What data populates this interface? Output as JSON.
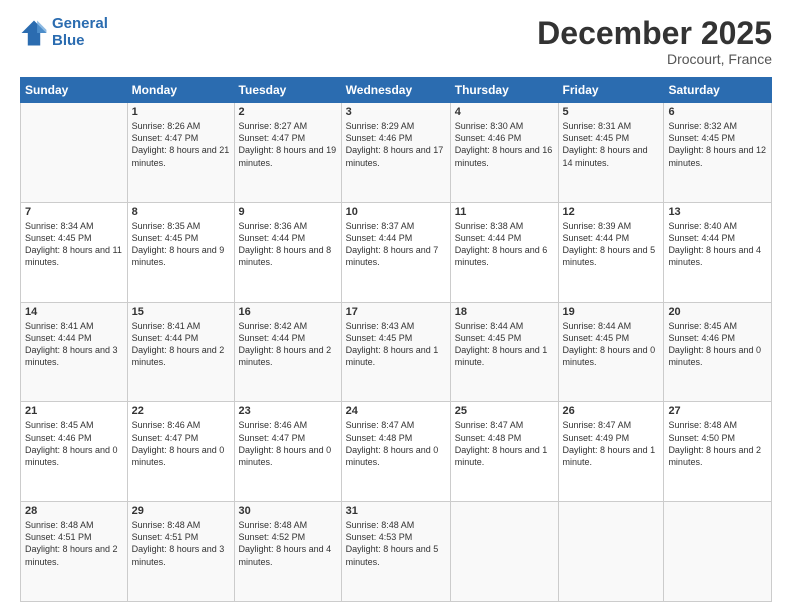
{
  "logo": {
    "line1": "General",
    "line2": "Blue"
  },
  "title": "December 2025",
  "location": "Drocourt, France",
  "header_days": [
    "Sunday",
    "Monday",
    "Tuesday",
    "Wednesday",
    "Thursday",
    "Friday",
    "Saturday"
  ],
  "weeks": [
    [
      {
        "day": "",
        "sunrise": "",
        "sunset": "",
        "daylight": ""
      },
      {
        "day": "1",
        "sunrise": "Sunrise: 8:26 AM",
        "sunset": "Sunset: 4:47 PM",
        "daylight": "Daylight: 8 hours and 21 minutes."
      },
      {
        "day": "2",
        "sunrise": "Sunrise: 8:27 AM",
        "sunset": "Sunset: 4:47 PM",
        "daylight": "Daylight: 8 hours and 19 minutes."
      },
      {
        "day": "3",
        "sunrise": "Sunrise: 8:29 AM",
        "sunset": "Sunset: 4:46 PM",
        "daylight": "Daylight: 8 hours and 17 minutes."
      },
      {
        "day": "4",
        "sunrise": "Sunrise: 8:30 AM",
        "sunset": "Sunset: 4:46 PM",
        "daylight": "Daylight: 8 hours and 16 minutes."
      },
      {
        "day": "5",
        "sunrise": "Sunrise: 8:31 AM",
        "sunset": "Sunset: 4:45 PM",
        "daylight": "Daylight: 8 hours and 14 minutes."
      },
      {
        "day": "6",
        "sunrise": "Sunrise: 8:32 AM",
        "sunset": "Sunset: 4:45 PM",
        "daylight": "Daylight: 8 hours and 12 minutes."
      }
    ],
    [
      {
        "day": "7",
        "sunrise": "Sunrise: 8:34 AM",
        "sunset": "Sunset: 4:45 PM",
        "daylight": "Daylight: 8 hours and 11 minutes."
      },
      {
        "day": "8",
        "sunrise": "Sunrise: 8:35 AM",
        "sunset": "Sunset: 4:45 PM",
        "daylight": "Daylight: 8 hours and 9 minutes."
      },
      {
        "day": "9",
        "sunrise": "Sunrise: 8:36 AM",
        "sunset": "Sunset: 4:44 PM",
        "daylight": "Daylight: 8 hours and 8 minutes."
      },
      {
        "day": "10",
        "sunrise": "Sunrise: 8:37 AM",
        "sunset": "Sunset: 4:44 PM",
        "daylight": "Daylight: 8 hours and 7 minutes."
      },
      {
        "day": "11",
        "sunrise": "Sunrise: 8:38 AM",
        "sunset": "Sunset: 4:44 PM",
        "daylight": "Daylight: 8 hours and 6 minutes."
      },
      {
        "day": "12",
        "sunrise": "Sunrise: 8:39 AM",
        "sunset": "Sunset: 4:44 PM",
        "daylight": "Daylight: 8 hours and 5 minutes."
      },
      {
        "day": "13",
        "sunrise": "Sunrise: 8:40 AM",
        "sunset": "Sunset: 4:44 PM",
        "daylight": "Daylight: 8 hours and 4 minutes."
      }
    ],
    [
      {
        "day": "14",
        "sunrise": "Sunrise: 8:41 AM",
        "sunset": "Sunset: 4:44 PM",
        "daylight": "Daylight: 8 hours and 3 minutes."
      },
      {
        "day": "15",
        "sunrise": "Sunrise: 8:41 AM",
        "sunset": "Sunset: 4:44 PM",
        "daylight": "Daylight: 8 hours and 2 minutes."
      },
      {
        "day": "16",
        "sunrise": "Sunrise: 8:42 AM",
        "sunset": "Sunset: 4:44 PM",
        "daylight": "Daylight: 8 hours and 2 minutes."
      },
      {
        "day": "17",
        "sunrise": "Sunrise: 8:43 AM",
        "sunset": "Sunset: 4:45 PM",
        "daylight": "Daylight: 8 hours and 1 minute."
      },
      {
        "day": "18",
        "sunrise": "Sunrise: 8:44 AM",
        "sunset": "Sunset: 4:45 PM",
        "daylight": "Daylight: 8 hours and 1 minute."
      },
      {
        "day": "19",
        "sunrise": "Sunrise: 8:44 AM",
        "sunset": "Sunset: 4:45 PM",
        "daylight": "Daylight: 8 hours and 0 minutes."
      },
      {
        "day": "20",
        "sunrise": "Sunrise: 8:45 AM",
        "sunset": "Sunset: 4:46 PM",
        "daylight": "Daylight: 8 hours and 0 minutes."
      }
    ],
    [
      {
        "day": "21",
        "sunrise": "Sunrise: 8:45 AM",
        "sunset": "Sunset: 4:46 PM",
        "daylight": "Daylight: 8 hours and 0 minutes."
      },
      {
        "day": "22",
        "sunrise": "Sunrise: 8:46 AM",
        "sunset": "Sunset: 4:47 PM",
        "daylight": "Daylight: 8 hours and 0 minutes."
      },
      {
        "day": "23",
        "sunrise": "Sunrise: 8:46 AM",
        "sunset": "Sunset: 4:47 PM",
        "daylight": "Daylight: 8 hours and 0 minutes."
      },
      {
        "day": "24",
        "sunrise": "Sunrise: 8:47 AM",
        "sunset": "Sunset: 4:48 PM",
        "daylight": "Daylight: 8 hours and 0 minutes."
      },
      {
        "day": "25",
        "sunrise": "Sunrise: 8:47 AM",
        "sunset": "Sunset: 4:48 PM",
        "daylight": "Daylight: 8 hours and 1 minute."
      },
      {
        "day": "26",
        "sunrise": "Sunrise: 8:47 AM",
        "sunset": "Sunset: 4:49 PM",
        "daylight": "Daylight: 8 hours and 1 minute."
      },
      {
        "day": "27",
        "sunrise": "Sunrise: 8:48 AM",
        "sunset": "Sunset: 4:50 PM",
        "daylight": "Daylight: 8 hours and 2 minutes."
      }
    ],
    [
      {
        "day": "28",
        "sunrise": "Sunrise: 8:48 AM",
        "sunset": "Sunset: 4:51 PM",
        "daylight": "Daylight: 8 hours and 2 minutes."
      },
      {
        "day": "29",
        "sunrise": "Sunrise: 8:48 AM",
        "sunset": "Sunset: 4:51 PM",
        "daylight": "Daylight: 8 hours and 3 minutes."
      },
      {
        "day": "30",
        "sunrise": "Sunrise: 8:48 AM",
        "sunset": "Sunset: 4:52 PM",
        "daylight": "Daylight: 8 hours and 4 minutes."
      },
      {
        "day": "31",
        "sunrise": "Sunrise: 8:48 AM",
        "sunset": "Sunset: 4:53 PM",
        "daylight": "Daylight: 8 hours and 5 minutes."
      },
      {
        "day": "",
        "sunrise": "",
        "sunset": "",
        "daylight": ""
      },
      {
        "day": "",
        "sunrise": "",
        "sunset": "",
        "daylight": ""
      },
      {
        "day": "",
        "sunrise": "",
        "sunset": "",
        "daylight": ""
      }
    ]
  ]
}
